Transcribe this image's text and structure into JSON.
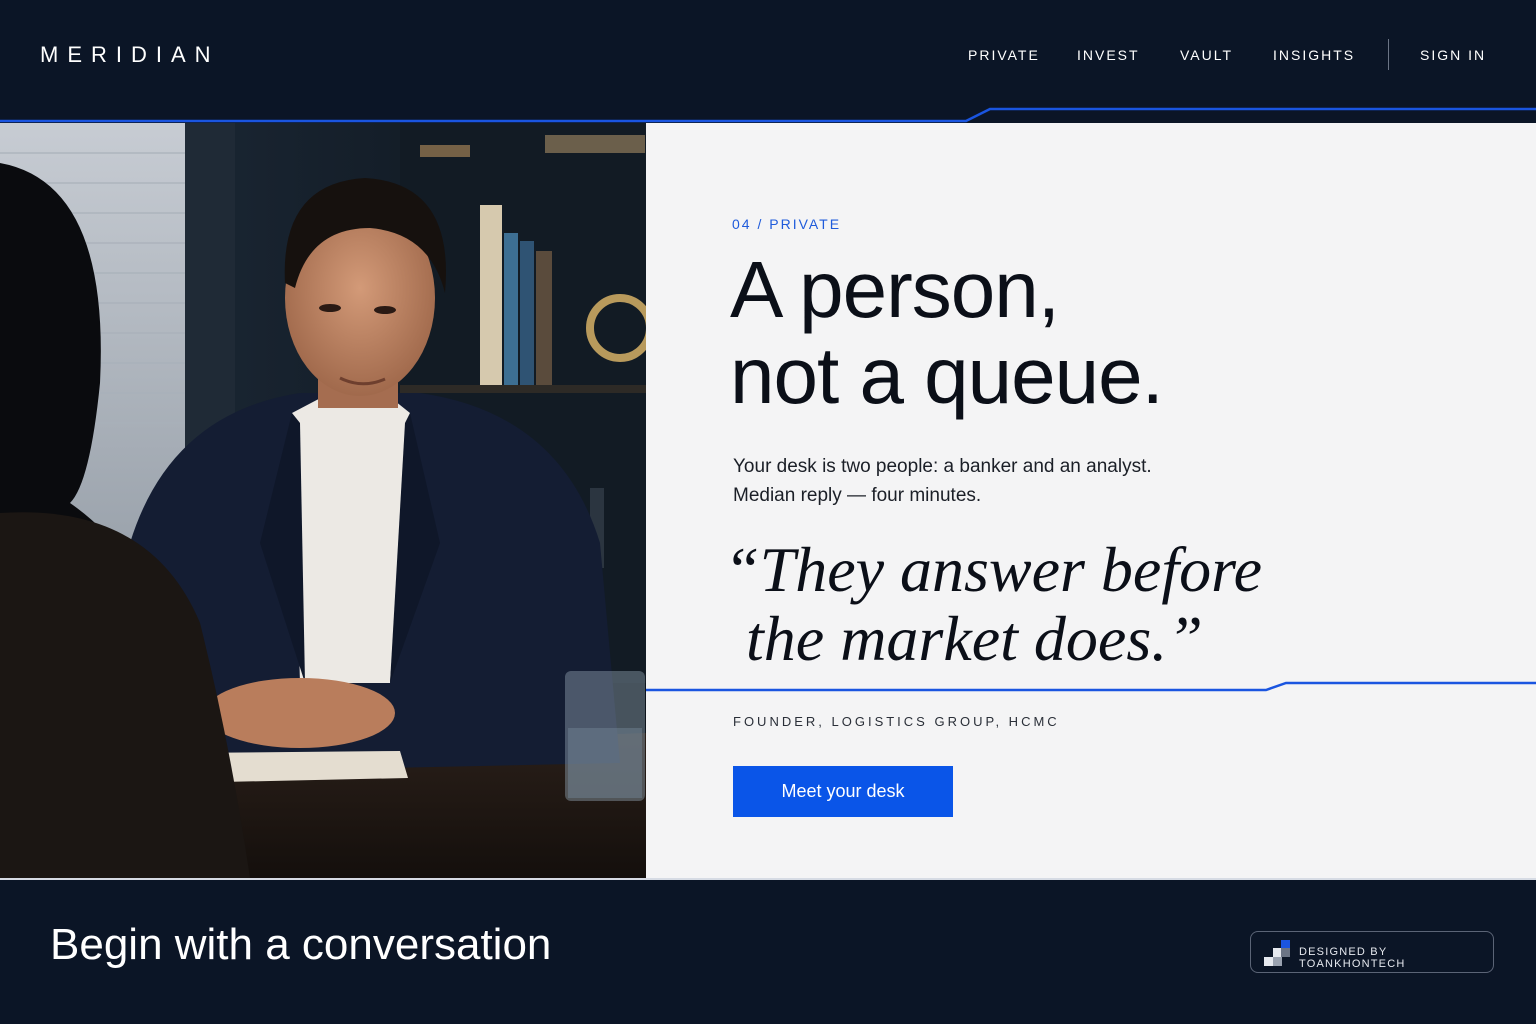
{
  "header": {
    "logo": "MERIDIAN",
    "nav": [
      "PRIVATE",
      "INVEST",
      "VAULT",
      "INSIGHTS"
    ],
    "sign_in": "SIGN IN"
  },
  "hero": {
    "eyebrow": "04 / PRIVATE",
    "headline_line1": "A person,",
    "headline_line2": "not a queue.",
    "desc_line1": "Your desk is two people: a banker and an analyst.",
    "desc_line2": "Median reply — four minutes.",
    "quote_line1": "“They answer before",
    "quote_line2": "the market does.”",
    "attribution": "FOUNDER, LOGISTICS GROUP, HCMC",
    "cta": "Meet your desk"
  },
  "footer": {
    "title": "Begin with a conversation",
    "badge": "DESIGNED BY TOANKHONTECH"
  },
  "colors": {
    "navy": "#0b1526",
    "accent": "#0a55e8",
    "panel": "#f4f4f5"
  },
  "icons": [
    "designer-badge-icon"
  ]
}
